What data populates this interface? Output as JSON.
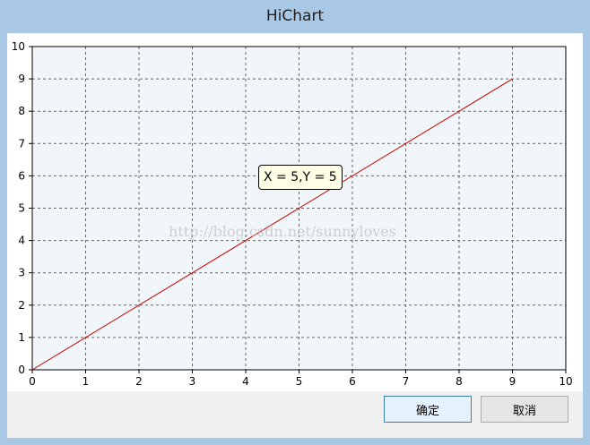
{
  "window": {
    "title": "HiChart"
  },
  "buttons": {
    "ok_label": "确定",
    "cancel_label": "取消"
  },
  "tooltip": {
    "text": "X = 5,Y = 5"
  },
  "watermark": {
    "text": "http://blog.csdn.net/sunnyloves"
  },
  "colors": {
    "line": "#cc0000",
    "plot_bg": "#f0f6f9",
    "grid": "#666666"
  },
  "chart_data": {
    "type": "line",
    "x_ticks": [
      "0",
      "1",
      "2",
      "3",
      "4",
      "5",
      "6",
      "7",
      "8",
      "9",
      "10"
    ],
    "y_ticks": [
      "0",
      "1",
      "2",
      "3",
      "4",
      "5",
      "6",
      "7",
      "8",
      "9",
      "10"
    ],
    "xlim": [
      0,
      10
    ],
    "ylim": [
      0,
      10
    ],
    "grid": true,
    "series": [
      {
        "x": [
          0,
          9
        ],
        "y": [
          0,
          9
        ]
      }
    ],
    "highlight": {
      "x": 5,
      "y": 5
    }
  }
}
